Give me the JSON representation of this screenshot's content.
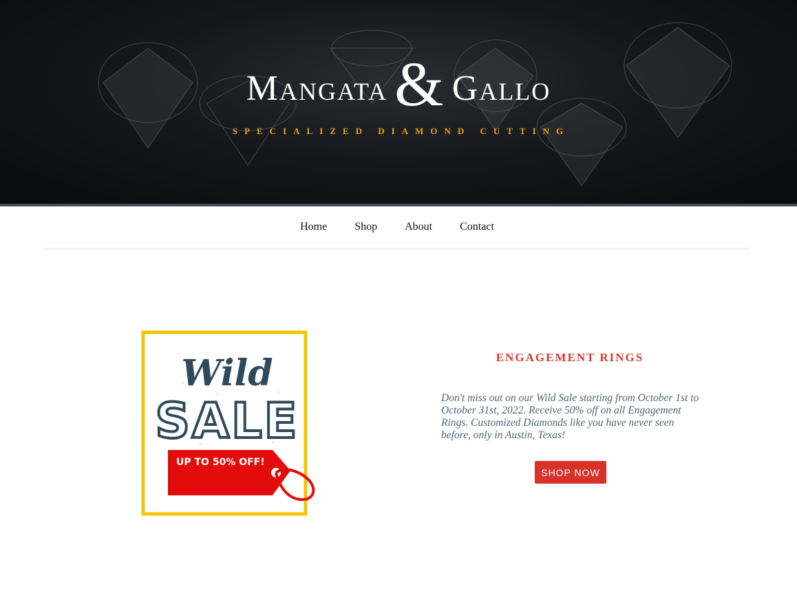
{
  "header": {
    "brand_left": "Mangata",
    "brand_amp": "&",
    "brand_right": "Gallo",
    "tagline": "SPECIALIZED DIAMOND CUTTING"
  },
  "nav": {
    "items": [
      {
        "label": "Home"
      },
      {
        "label": "Shop"
      },
      {
        "label": "About"
      },
      {
        "label": "Contact"
      }
    ]
  },
  "promo": {
    "image": {
      "line1": "Wild",
      "line2": "SALE",
      "tag_text": "UP TO 50% OFF!"
    },
    "title": "ENGAGEMENT RINGS",
    "body": "Don't miss out on our Wild Sale starting from October 1st to October 31st, 2022. Receive 50% off on all Engagement Rings. Customized Diamonds like you have never seen before, only in Austin, Texas!",
    "button_label": "SHOP NOW"
  },
  "colors": {
    "accent_red": "#d9322b",
    "tagline_gold": "#e8a21a",
    "frame_yellow": "#f6c400",
    "sale_slate": "#2f4a5a",
    "body_text": "#4e6472"
  }
}
